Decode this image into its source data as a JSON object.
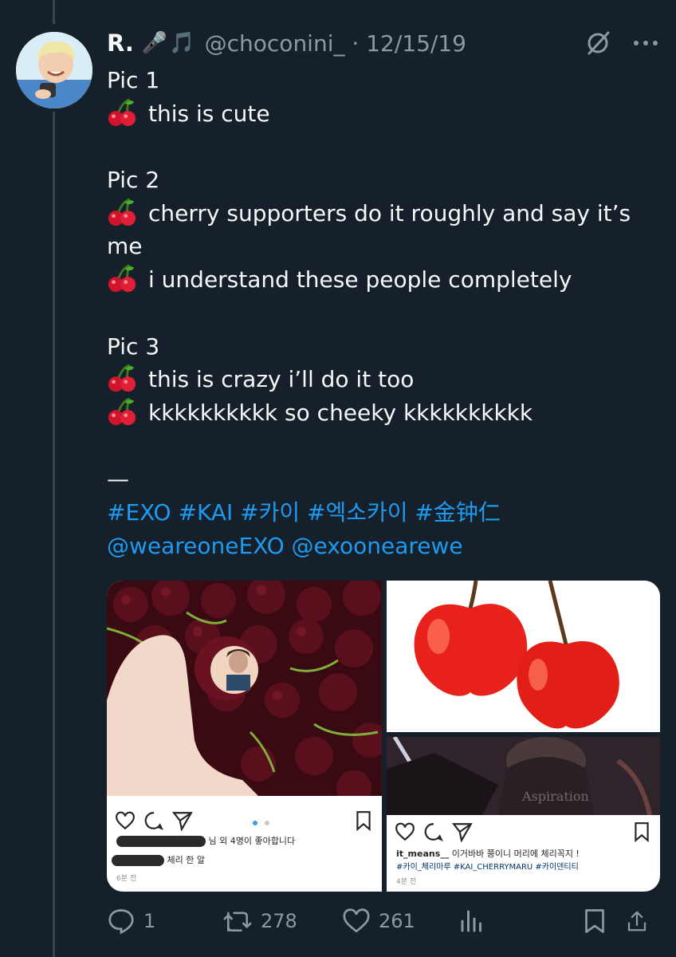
{
  "author": {
    "name": "R.",
    "name_emoji": "🎤🎵",
    "handle": "@choconini_",
    "date": "· 12/15/19"
  },
  "tweet_lines": [
    {
      "cherry": false,
      "text": "Pic 1"
    },
    {
      "cherry": true,
      "text": "this is cute"
    },
    {
      "cherry": false,
      "text": ""
    },
    {
      "cherry": false,
      "text": "Pic 2"
    },
    {
      "cherry": true,
      "text": "cherry supporters do it roughly and say it’s"
    },
    {
      "cherry": false,
      "text": "me"
    },
    {
      "cherry": true,
      "text": "i understand these people completely"
    },
    {
      "cherry": false,
      "text": ""
    },
    {
      "cherry": false,
      "text": "Pic 3"
    },
    {
      "cherry": true,
      "text": "this is crazy i’ll do it too"
    },
    {
      "cherry": true,
      "text": "kkkkkkkkkk so cheeky kkkkkkkkkk"
    },
    {
      "cherry": false,
      "text": ""
    },
    {
      "cherry": false,
      "text": "—"
    }
  ],
  "hashtags": "#EXO #KAI #카이 #엑소카이 #金钟仁",
  "mentions": "@weareoneEXO @exoonearewe",
  "media": {
    "left_post": {
      "likes_text": "님 외 4명이 좋아합니다",
      "comment_text": "체리 한 알",
      "time": "6분 전"
    },
    "right_post": {
      "username": "it_means__",
      "caption": "이거바바 쭁이니 머리에 체리꼭지 !",
      "tags": "#카이_체리마루 #KAI_CHERRYMARU #카이덴티티",
      "time": "4분 전",
      "shirt_text": "Aspiration"
    }
  },
  "stats": {
    "replies": "1",
    "retweets": "278",
    "likes": "261"
  },
  "colors": {
    "background": "#15202b",
    "text": "#f7f9f9",
    "muted": "#8b98a5",
    "link": "#1d9bf0"
  }
}
